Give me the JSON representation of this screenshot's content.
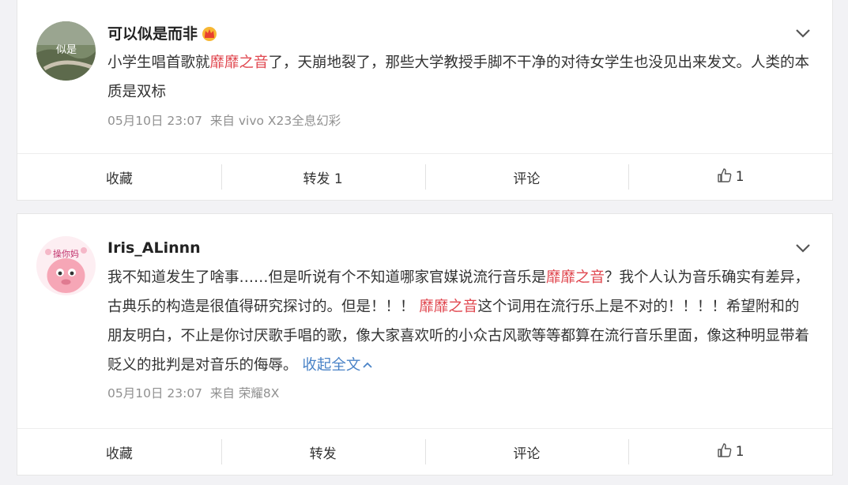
{
  "posts": [
    {
      "username": "可以似是而非",
      "content": [
        {
          "text": "小学生唱首歌就"
        },
        {
          "text": "靡靡之音",
          "hl": true
        },
        {
          "text": "了，天崩地裂了，那些大学教授手脚不干净的对待女学生也没见出来发文。人类的本质是双标"
        }
      ],
      "time": "05月10日 23:07",
      "source": "来自 vivo X23全息幻彩",
      "actions": {
        "collect": "收藏",
        "repost": "转发 1",
        "comment": "评论",
        "like_count": "1"
      }
    },
    {
      "username": "Iris_ALinnn",
      "content": [
        {
          "text": "我不知道发生了啥事……但是听说有个不知道哪家官媒说流行音乐是"
        },
        {
          "text": "靡靡之音",
          "hl": true
        },
        {
          "text": "？我个人认为音乐确实有差异，古典乐的构造是很值得研究探讨的。但是！！！ "
        },
        {
          "text": "靡靡之音",
          "hl": true
        },
        {
          "text": "这个词用在流行乐上是不对的！！！！希望附和的朋友明白，不止是你讨厌歌手唱的歌，像大家喜欢听的小众古风歌等等都算在流行音乐里面，像这种明显带着贬义的批判是对音乐的侮辱。 "
        }
      ],
      "collapse_label": "收起全文",
      "avatar_text": "操你妈",
      "time": "05月10日 23:07",
      "source": "来自 荣耀8X",
      "actions": {
        "collect": "收藏",
        "repost": "转发",
        "comment": "评论",
        "like_count": "1"
      }
    }
  ],
  "colors": {
    "highlight": "#e0474f",
    "link": "#4a83c7",
    "meta": "#909090",
    "background": "#f2f2f5"
  }
}
